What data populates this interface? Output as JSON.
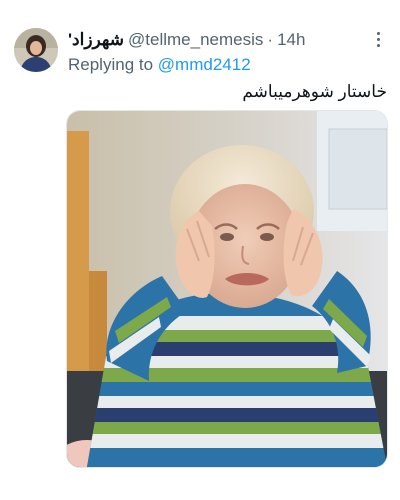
{
  "tweet": {
    "display_name": "شهرزاد'",
    "handle": "@tellme_nemesis",
    "separator": "·",
    "time": "14h",
    "reply_prefix": "Replying to",
    "reply_to": "@mmd2412",
    "text": "خاستار شوهرمیباشم",
    "more_icon": "more-vertical-icon",
    "avatar_icon": "avatar",
    "media_description_icon": "crying-toddler-photo"
  },
  "colors": {
    "secondary_text": "#536471",
    "link": "#1d9bf0",
    "primary_text": "#0f1419"
  }
}
